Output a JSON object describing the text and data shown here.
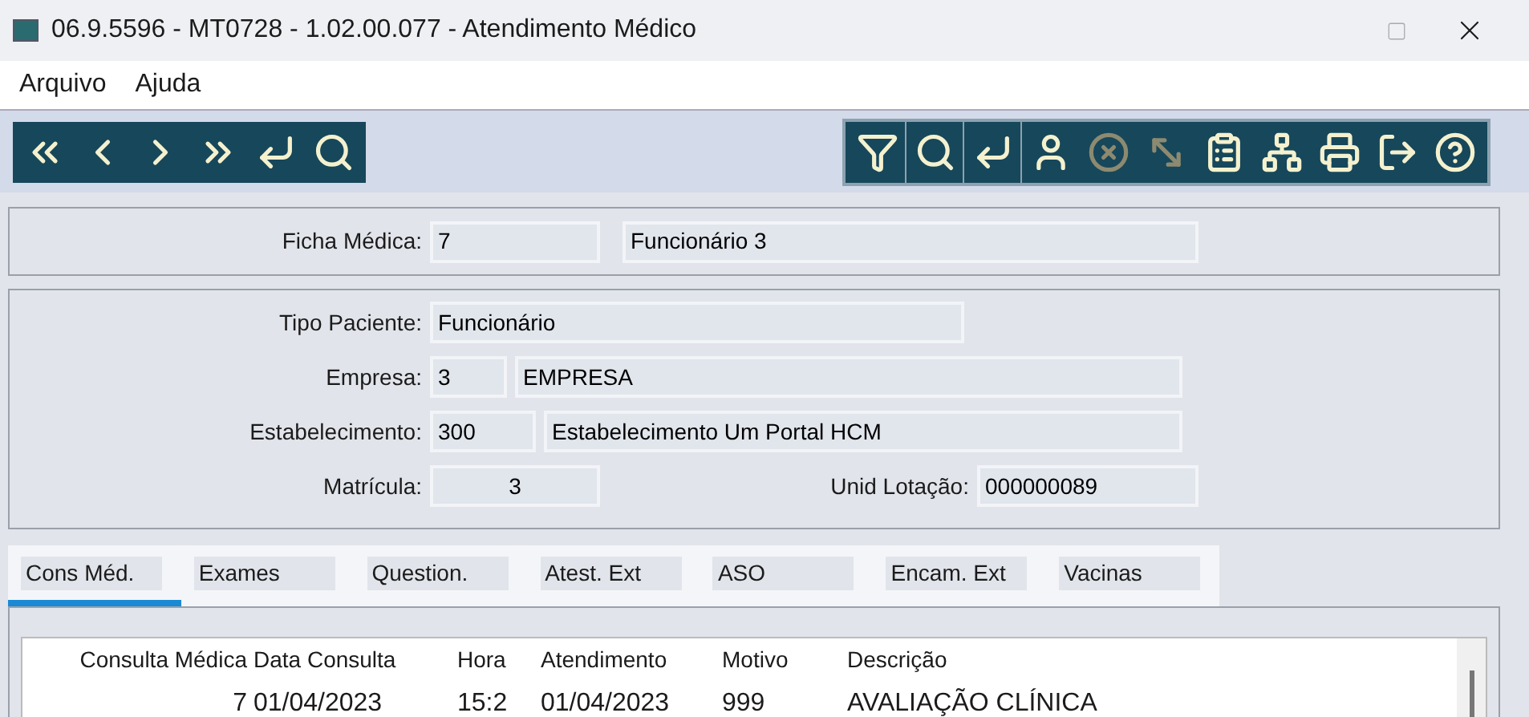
{
  "window": {
    "title": "06.9.5596 - MT0728 - 1.02.00.077 - Atendimento Médico"
  },
  "menu": [
    "Arquivo",
    "Ajuda"
  ],
  "toolbar": {
    "left": [
      {
        "kind": "first",
        "disabled": false
      },
      {
        "kind": "prev",
        "disabled": false
      },
      {
        "kind": "next",
        "disabled": false
      },
      {
        "kind": "last",
        "disabled": false
      },
      {
        "kind": "goto",
        "disabled": false
      },
      {
        "kind": "search",
        "disabled": false
      }
    ],
    "right": [
      {
        "kind": "filter",
        "disabled": false
      },
      {
        "kind": "search",
        "disabled": false
      },
      {
        "kind": "goto",
        "disabled": false
      },
      {
        "kind": "user",
        "disabled": false
      },
      {
        "kind": "cancel",
        "disabled": true
      },
      {
        "kind": "expand",
        "disabled": true
      },
      {
        "kind": "clipboard",
        "disabled": false
      },
      {
        "kind": "tree",
        "disabled": false
      },
      {
        "kind": "print",
        "disabled": false
      },
      {
        "kind": "exit",
        "disabled": false
      },
      {
        "kind": "help",
        "disabled": false
      }
    ]
  },
  "header": {
    "label": "Ficha Médica:",
    "code": "7",
    "name": "Funcionário 3"
  },
  "patient": {
    "tipo_label": "Tipo Paciente:",
    "tipo": "Funcionário",
    "empresa_label": "Empresa:",
    "empresa_code": "3",
    "empresa_name": "EMPRESA",
    "estab_label": "Estabelecimento:",
    "estab_code": "300",
    "estab_name": "Estabelecimento Um Portal HCM",
    "matricula_label": "Matrícula:",
    "matricula": "3",
    "unid_label": "Unid Lotação:",
    "unid": "000000089"
  },
  "tabs": [
    {
      "label": "Cons Méd.",
      "selected": true
    },
    {
      "label": "Exames",
      "selected": false
    },
    {
      "label": "Question.",
      "selected": false
    },
    {
      "label": "Atest. Ext",
      "selected": false
    },
    {
      "label": "ASO",
      "selected": false
    },
    {
      "label": "Encam. Ext",
      "selected": false
    },
    {
      "label": "Vacinas",
      "selected": false
    }
  ],
  "table": {
    "columns": [
      "Consulta Médica",
      "Data Consulta",
      "Hora",
      "Atendimento",
      "Motivo",
      "Descrição"
    ],
    "rows": [
      [
        "7",
        "01/04/2023",
        "15:2",
        "01/04/2023",
        "999",
        "AVALIAÇÃO CLÍNICA"
      ]
    ]
  }
}
